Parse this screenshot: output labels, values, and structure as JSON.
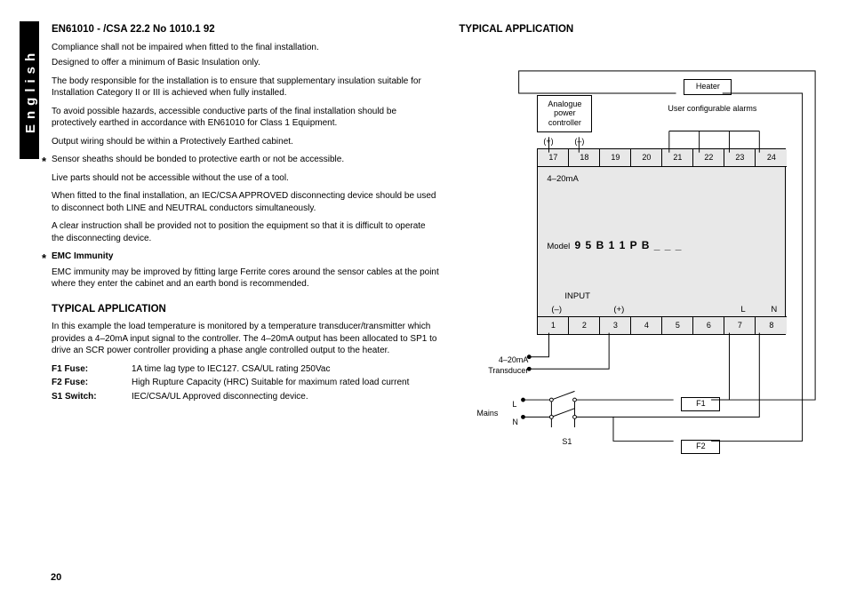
{
  "sideTab": "English",
  "pageNumber": "20",
  "left": {
    "heading1": "EN61010 - /CSA 22.2 No 1010.1 92",
    "p1": "Compliance shall not be impaired when fitted to the final installation.",
    "p2": "Designed to offer a minimum of Basic Insulation only.",
    "p3": "The body responsible for the installation is to ensure that supplementary insulation suitable for Installation Category II or III is achieved when fully installed.",
    "p4": "To avoid possible hazards, accessible conductive parts of the final installation should be protectively earthed in accordance with EN61010 for Class 1 Equipment.",
    "p5": "Output wiring should be within a Protectively Earthed cabinet.",
    "p6": "Sensor sheaths should be bonded to protective earth or not be accessible.",
    "p7": "Live parts should not be accessible without the use of a tool.",
    "p8": "When fitted to the final installation, an IEC/CSA APPROVED disconnecting device should be used to disconnect both LINE and NEUTRAL conductors simultaneously.",
    "p9": "A clear instruction shall be provided not to position the equipment so that it is difficult to operate the disconnecting device.",
    "emcHeading": "EMC Immunity",
    "p10": "EMC immunity may be improved by fitting large Ferrite cores around the sensor cables at the point where they enter the cabinet and an earth bond is recommended.",
    "heading2": "TYPICAL APPLICATION",
    "p11": "In this example the load temperature is monitored by a temperature transducer/transmitter which provides a 4–20mA input signal to the controller. The 4–20mA output has been allocated to SP1 to drive an SCR power controller providing a phase angle controlled output to the heater.",
    "tbl": {
      "f1k": "F1 Fuse:",
      "f1v": "1A time lag type to IEC127. CSA/UL rating 250Vac",
      "f2k": "F2 Fuse:",
      "f2v": "High Rupture Capacity (HRC) Suitable for maximum rated load current",
      "s1k": "S1 Switch:",
      "s1v": "IEC/CSA/UL Approved disconnecting device."
    }
  },
  "right": {
    "heading": "TYPICAL APPLICATION",
    "diagram": {
      "heaterLabel": "Heater",
      "analogueLabel": "Analogue power controller",
      "alarmsLabel": "User configurable alarms",
      "plus1": "(+)",
      "minus1": "(–)",
      "plus2": "(+)",
      "minus2": "(–)",
      "topTerms": [
        "17",
        "18",
        "19",
        "20",
        "21",
        "22",
        "23",
        "24"
      ],
      "botTerms": [
        "1",
        "2",
        "3",
        "4",
        "5",
        "6",
        "7",
        "8"
      ],
      "out420": "4–20mA",
      "modelLabel": "Model",
      "modelValue": "9 5 B 1 1 P B _ _ _",
      "inputLabel": "INPUT",
      "LN_L": "L",
      "LN_N": "N",
      "transducer1": "4–20mA",
      "transducer2": "Transducer",
      "mainsL": "L",
      "mainsN": "N",
      "mainsLabel": "Mains",
      "s1": "S1",
      "f1": "F1",
      "f2": "F2"
    }
  }
}
